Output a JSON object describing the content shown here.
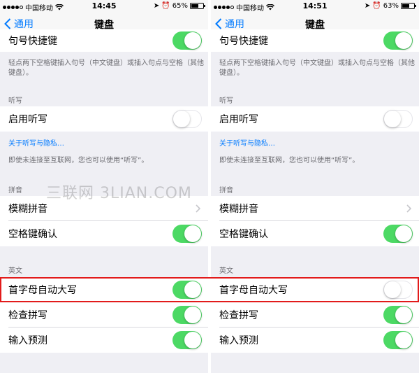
{
  "screens": [
    {
      "status": {
        "carrier": "中国移动",
        "time": "14:45",
        "battery": "65%"
      },
      "nav": {
        "back": "通用",
        "title": "键盘"
      },
      "rows": {
        "period_shortcut": "句号快捷键",
        "period_note": "轻点两下空格键插入句号（中文键盘）或插入句点与空格（其他键盘）。",
        "dictation_header": "听写",
        "enable_dictation": "启用听写",
        "dictation_link": "关于听写与隐私…",
        "dictation_note": "即使未连接至互联网，您也可以使用“听写”。",
        "pinyin_header": "拼音",
        "fuzzy_pinyin": "模糊拼音",
        "space_confirm": "空格键确认",
        "english_header": "英文",
        "auto_cap": "首字母自动大写",
        "check_spelling": "检查拼写",
        "predictive": "输入预测"
      },
      "toggles": {
        "period_shortcut": true,
        "enable_dictation": false,
        "space_confirm": true,
        "auto_cap": true,
        "check_spelling": true,
        "predictive": true
      }
    },
    {
      "status": {
        "carrier": "中国移动",
        "time": "14:51",
        "battery": "63%"
      },
      "nav": {
        "back": "通用",
        "title": "键盘"
      },
      "rows": {
        "period_shortcut": "句号快捷键",
        "period_note": "轻点两下空格键插入句号（中文键盘）或插入句点与空格（其他键盘）。",
        "dictation_header": "听写",
        "enable_dictation": "启用听写",
        "dictation_link": "关于听写与隐私…",
        "dictation_note": "即使未连接至互联网，您也可以使用“听写”。",
        "pinyin_header": "拼音",
        "fuzzy_pinyin": "模糊拼音",
        "space_confirm": "空格键确认",
        "english_header": "英文",
        "auto_cap": "首字母自动大写",
        "check_spelling": "检查拼写",
        "predictive": "输入预测"
      },
      "toggles": {
        "period_shortcut": true,
        "enable_dictation": false,
        "space_confirm": true,
        "auto_cap": false,
        "check_spelling": true,
        "predictive": true
      }
    }
  ],
  "watermark": "三联网 3LIAN.COM",
  "colors": {
    "accent": "#007aff",
    "toggle_on": "#4cd964",
    "highlight": "#e21b1b"
  }
}
